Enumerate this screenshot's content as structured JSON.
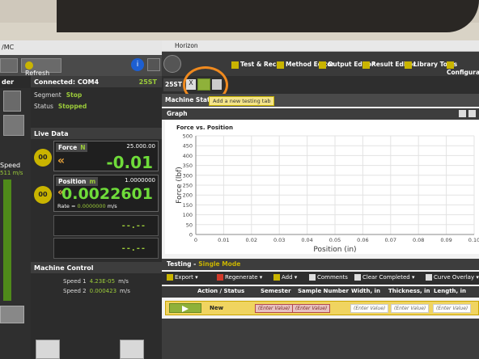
{
  "left_app": {
    "title_fragment": "/MC",
    "refresh_label": "Refresh",
    "col_a": {
      "header": "der",
      "speed_label": "Speed",
      "speed_value": "511 m/s"
    },
    "connection": {
      "label": "Connected: COM4",
      "tag": "25ST"
    },
    "segment": {
      "label": "Segment",
      "value": "Stop"
    },
    "status": {
      "label": "Status",
      "value": "Stopped"
    },
    "live_data_header": "Live Data",
    "force": {
      "label": "Force",
      "unit": "N",
      "max": "25.000.00",
      "value": "-0.01"
    },
    "position": {
      "label": "Position",
      "unit": "m",
      "max": "1.0000000",
      "value": "0.0022601"
    },
    "rate": {
      "label": "Rate =",
      "value": "0.0000000",
      "unit": "m/s"
    },
    "dashes_1": "--.--",
    "dashes_2": "--.--",
    "machine_control_header": "Machine Control",
    "speed1": {
      "label": "Speed 1",
      "value": "4.23E-05",
      "unit": "m/s"
    },
    "speed2": {
      "label": "Speed 2",
      "value": "0.000423",
      "unit": "m/s"
    }
  },
  "horizon": {
    "title": "Horizon",
    "menu": [
      {
        "label": "Test & Recall"
      },
      {
        "label": "Method Editor"
      },
      {
        "label": "Output Editor"
      },
      {
        "label": "Result Editor"
      },
      {
        "label": "Library Tools"
      },
      {
        "label": "Configuratio"
      }
    ],
    "tab_label": "25ST",
    "tab_close": "X",
    "machine_status_label": "Machine Status:",
    "tooltip": "Add a new testing tab",
    "graph_header": "Graph",
    "testing_header": "Testing -",
    "testing_mode": "Single Mode",
    "toolbar": {
      "export": "Export",
      "regenerate": "Regenerate",
      "add": "Add",
      "comments": "Comments",
      "clear_completed": "Clear Completed",
      "curve_overlay": "Curve Overlay"
    },
    "columns": {
      "action_status": "Action / Status",
      "semester": "Semester",
      "sample_number": "Sample Number",
      "width": "Width, in",
      "thickness": "Thickness, in",
      "length": "Length, in"
    },
    "row": {
      "status": "New",
      "semester": "(Enter Value)",
      "sample_number": "(Enter Value)",
      "width": "(Enter Value)",
      "thickness": "(Enter Value)",
      "length": "(Enter Value)"
    }
  },
  "chart_data": {
    "type": "line",
    "title": "Force vs. Position",
    "xlabel": "Position (in)",
    "ylabel": "Force (lbf)",
    "xlim": [
      0,
      0.1
    ],
    "ylim": [
      0,
      500
    ],
    "x_ticks": [
      "0",
      "0.01",
      "0.02",
      "0.03",
      "0.04",
      "0.05",
      "0.06",
      "0.07",
      "0.08",
      "0.09",
      "0.10"
    ],
    "y_ticks": [
      "0",
      "50",
      "100",
      "150",
      "200",
      "250",
      "300",
      "350",
      "400",
      "450",
      "500"
    ],
    "grid": true,
    "series": []
  }
}
